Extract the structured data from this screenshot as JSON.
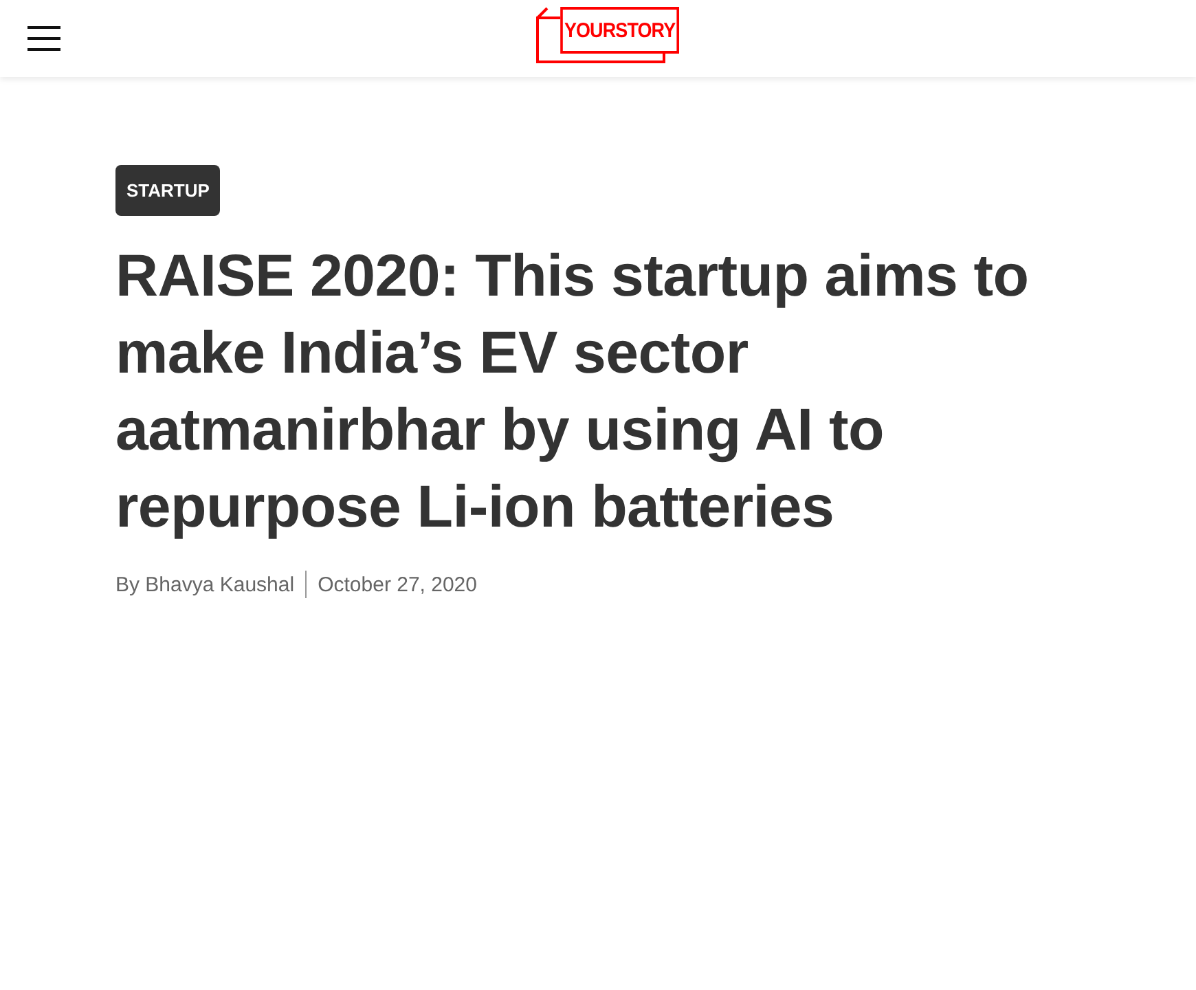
{
  "header": {
    "logo": "YOURSTORY"
  },
  "article": {
    "category": "STARTUP",
    "title": "RAISE 2020: This startup aims to make India’s EV sector aatmanirbhar by using AI to repurpose Li-ion batteries",
    "author": "By Bhavya Kaushal",
    "date": "October 27, 2020"
  }
}
